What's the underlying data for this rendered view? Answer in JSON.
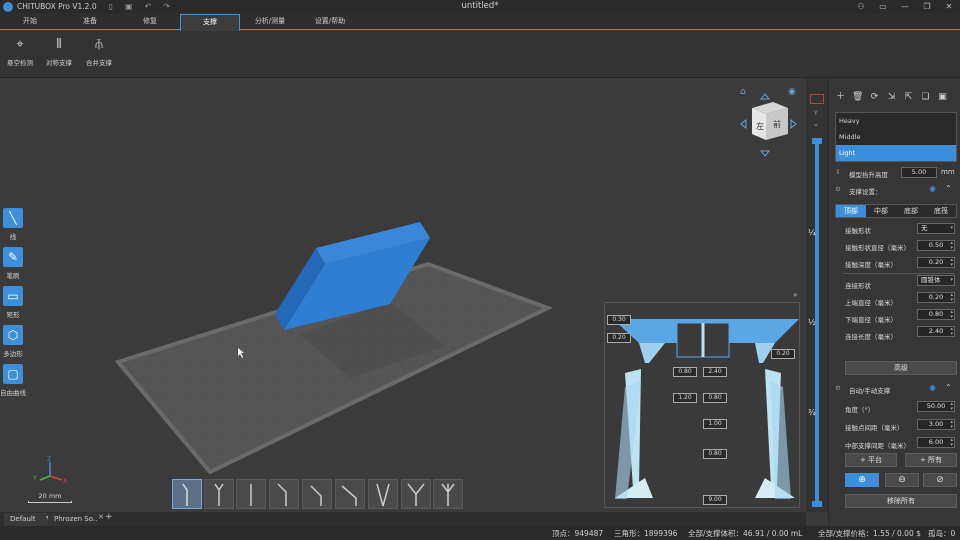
{
  "app": {
    "name": "CHITUBOX Pro V1.2.0",
    "doc_title": "untitled*"
  },
  "menu": {
    "tabs": [
      "开始",
      "准备",
      "修复",
      "支撑",
      "分析/测量",
      "设置/帮助"
    ],
    "active": "支撑"
  },
  "ribbon": [
    {
      "label": "悬空检测",
      "icon": "overhang-detect-icon"
    },
    {
      "label": "对称支撑",
      "icon": "symmetric-support-icon"
    },
    {
      "label": "合并支撑",
      "icon": "merge-support-icon"
    }
  ],
  "left_tools": [
    "线",
    "笔刷",
    "矩形",
    "多边形",
    "自由曲线"
  ],
  "scale_label": "20 mm",
  "diagram": {
    "values": [
      "0.30",
      "0.20",
      "0.20",
      "0.80",
      "2.40",
      "1.20",
      "0.80",
      "1.00",
      "0.80",
      "9.00"
    ]
  },
  "bottom_tabs": [
    "Default",
    "Phrozen So..."
  ],
  "status": {
    "vertices": "顶点：949487",
    "triangles": "三角形：1899396",
    "volume": "全部/支撑体积：46.91 / 0.00 mL",
    "price": "全部/支撑价格：1.55 / 0.00 $",
    "islands": "孤岛：0"
  },
  "slider": {
    "fracs": [
      "¼",
      "½",
      "¾"
    ]
  },
  "panel": {
    "presets": [
      "Heavy",
      "Middle",
      "Light"
    ],
    "selected_preset": "Light",
    "raise_label": "模型抬升高度",
    "raise_value": "5.00",
    "raise_unit": "mm",
    "support_settings": "支撑设置：",
    "subtabs": [
      "顶部",
      "中部",
      "底部",
      "底筏"
    ],
    "top": {
      "contact_shape_label": "接触形状",
      "contact_shape_value": "无",
      "contact_diameter_label": "接触形状直径（毫米）",
      "contact_diameter_value": "0.50",
      "contact_depth_label": "接触深度（毫米）",
      "contact_depth_value": "0.20",
      "connect_shape_label": "连接形状",
      "connect_shape_value": "圆锥体",
      "upper_diameter_label": "上端直径（毫米）",
      "upper_diameter_value": "0.20",
      "lower_diameter_label": "下端直径（毫米）",
      "lower_diameter_value": "0.80",
      "connect_length_label": "连接长度（毫米）",
      "connect_length_value": "2.40"
    },
    "advanced": "高级",
    "auto_manual": "自动/手动支撑",
    "angle_label": "角度（°）",
    "angle_value": "50.00",
    "contact_spacing_label": "接触点间距（毫米）",
    "contact_spacing_value": "3.00",
    "mid_spacing_label": "中部支撑间距（毫米）",
    "mid_spacing_value": "6.00",
    "platform_btn": "+ 平台",
    "all_btn": "+ 所有",
    "remove_all": "移除所有"
  }
}
